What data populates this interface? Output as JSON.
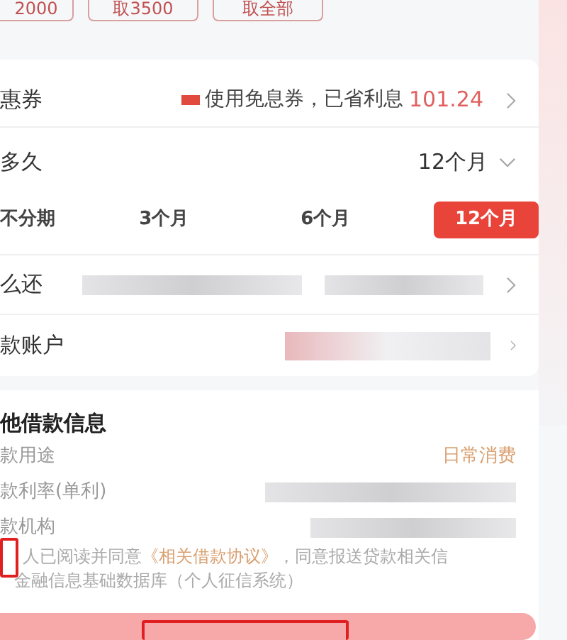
{
  "amount_options": [
    {
      "label": "2000"
    },
    {
      "label": "取3500"
    },
    {
      "label": "取全部"
    }
  ],
  "coupon": {
    "label": "惠券",
    "text": "使用免息券，已省利息",
    "saving": "101.24"
  },
  "term": {
    "label": "多久",
    "value": "12个月"
  },
  "term_tabs": [
    {
      "label": "不分期",
      "selected": false
    },
    {
      "label": "3个月",
      "selected": false
    },
    {
      "label": "6个月",
      "selected": false
    },
    {
      "label": "12个月",
      "selected": true
    }
  ],
  "repayment": {
    "label": "么还"
  },
  "account": {
    "label": "款账户"
  },
  "other_info": {
    "title": "他借款信息",
    "rows": [
      {
        "label": "款用途",
        "value": "日常消费"
      },
      {
        "label": "款利率(单利)"
      },
      {
        "label": "款机构"
      }
    ]
  },
  "agreement": {
    "text": "人已阅读并同意",
    "link": "《相关借款协议》",
    "rest": "，同意报送贷款相关信",
    "line2": "金融信息基础数据库（个人征信系统）"
  }
}
